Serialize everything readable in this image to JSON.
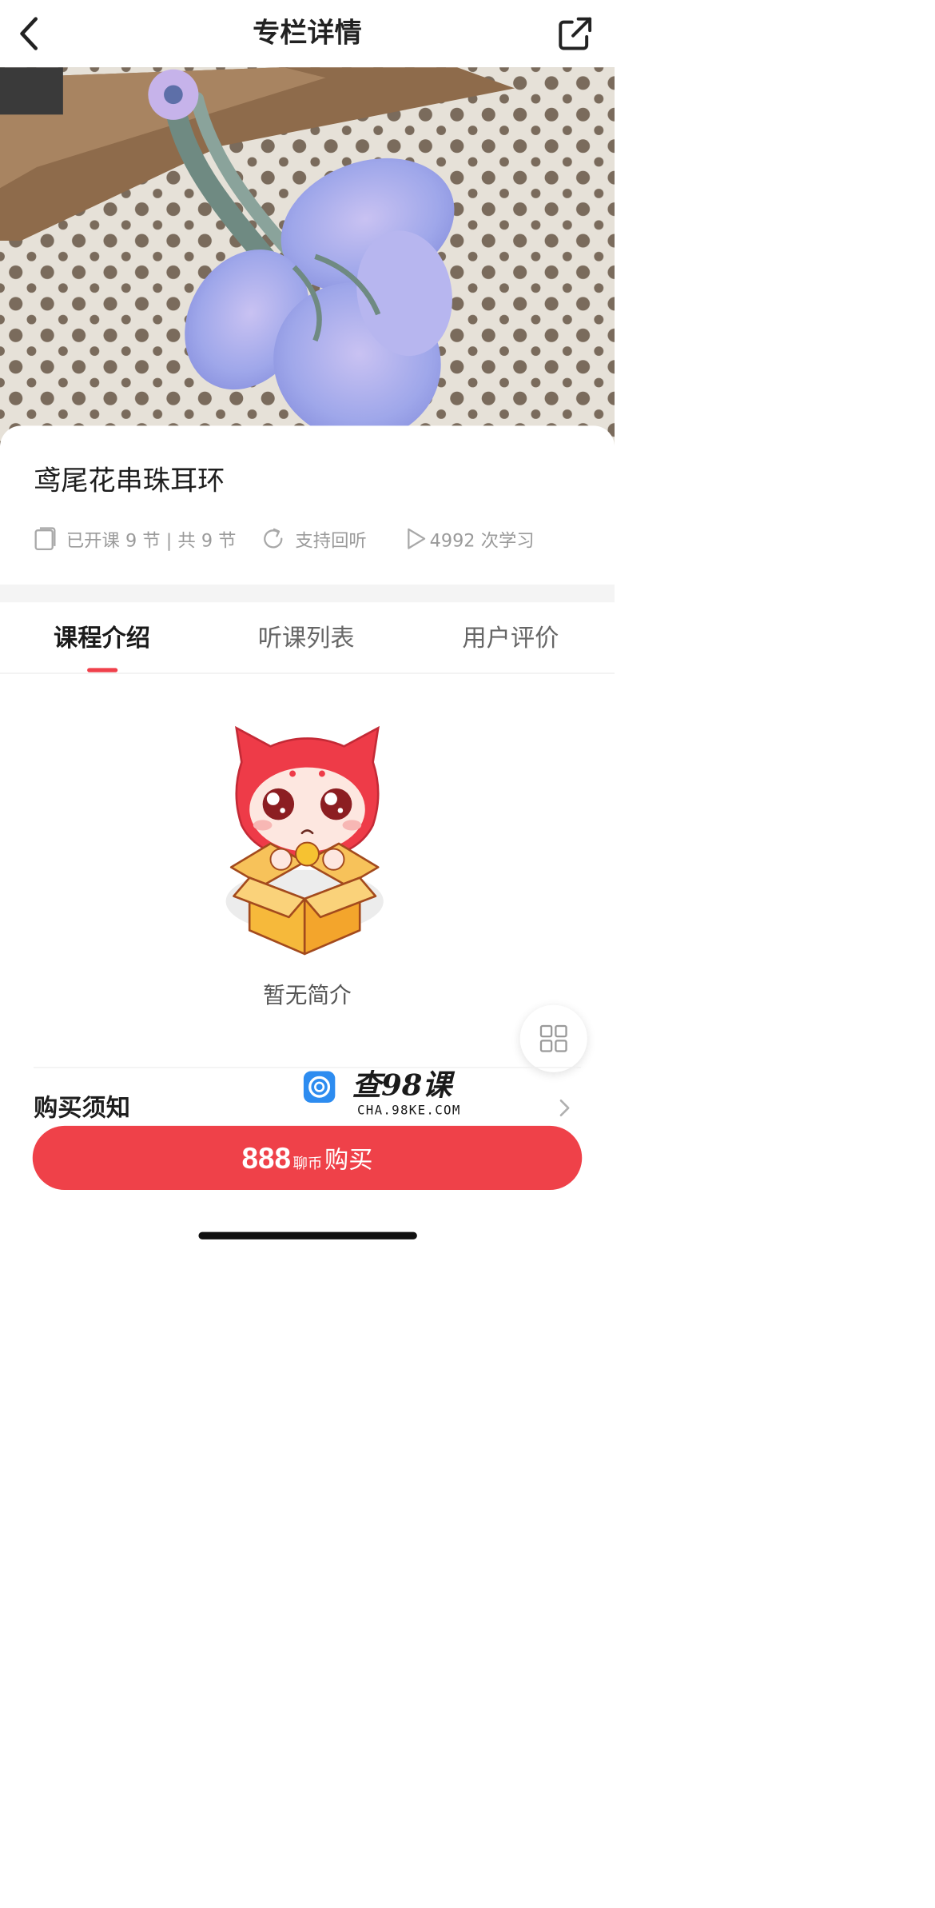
{
  "header": {
    "title": "专栏详情",
    "back_icon": "chevron-left-icon",
    "share_icon": "share-external-icon"
  },
  "course": {
    "title": "鸢尾花串珠耳环",
    "lessons_text": "已开课 9 节 | 共 9 节",
    "replay_text": "支持回听",
    "plays_text": "4992 次学习"
  },
  "tabs": [
    {
      "label": "课程介绍",
      "active": true
    },
    {
      "label": "听课列表",
      "active": false
    },
    {
      "label": "用户评价",
      "active": false
    }
  ],
  "empty_state": {
    "text": "暂无简介"
  },
  "notice": {
    "label": "购买须知"
  },
  "watermark": {
    "name": "查98课",
    "domain": "CHA.98KE.COM"
  },
  "purchase": {
    "price": "888",
    "currency_unit": "聊币",
    "label": "购买"
  },
  "colors": {
    "accent": "#ef4149",
    "tab_indicator": "#f0404b",
    "muted_text": "#9a9a9a"
  }
}
